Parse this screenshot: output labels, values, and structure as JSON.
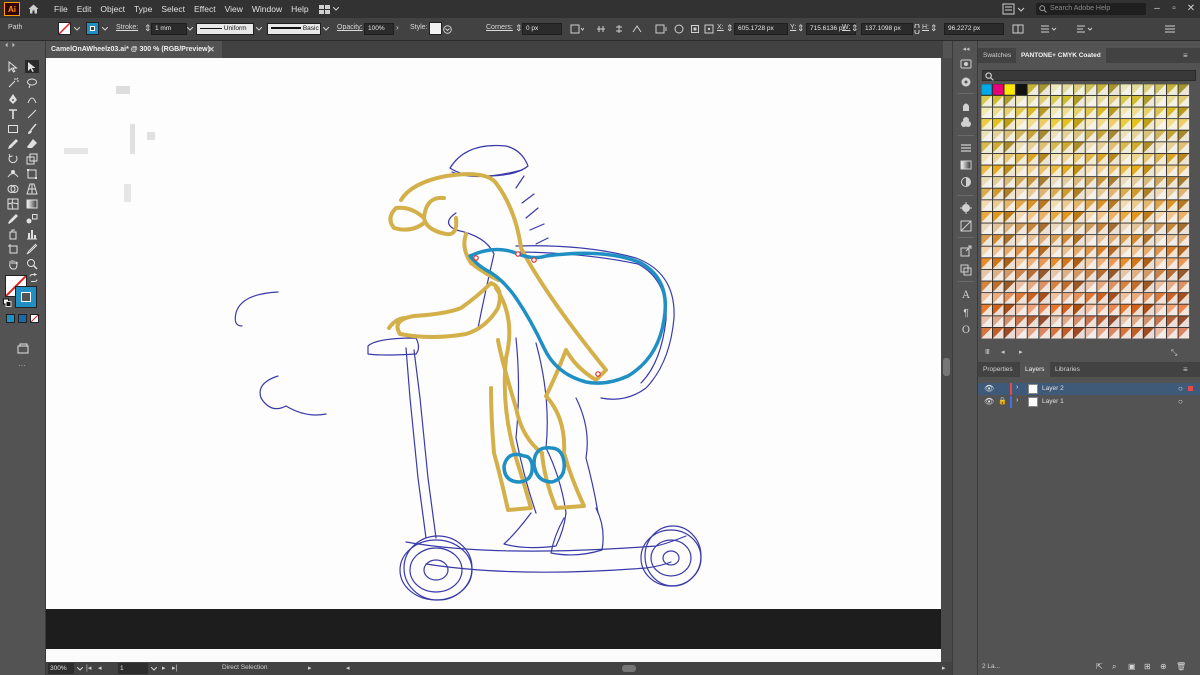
{
  "app": {
    "logo": "Ai",
    "menus": [
      "File",
      "Edit",
      "Object",
      "Type",
      "Select",
      "Effect",
      "View",
      "Window",
      "Help"
    ],
    "search_placeholder": "Search Adobe Help"
  },
  "control_bar": {
    "selection_type": "Path",
    "stroke_label": "Stroke:",
    "stroke_weight": "1 mm",
    "stroke_profile": "Uniform",
    "brush": "Basic",
    "opacity_label": "Opacity:",
    "opacity_value": "100%",
    "style_label": "Style:",
    "corners_label": "Corners:",
    "corners_value": "0 px",
    "x_label": "X:",
    "x_value": "605.1728 px",
    "y_label": "Y:",
    "y_value": "715.6136 px",
    "w_label": "W:",
    "w_value": "137.1098 px",
    "h_label": "H:",
    "h_value": "96.2272 px"
  },
  "document": {
    "tab_title": "CamelOnAWheelz03.ai* @ 300 % (RGB/Preview)"
  },
  "status_bar": {
    "zoom": "300%",
    "artboard_number": "1",
    "tool_name": "Direct Selection"
  },
  "swatches_panel": {
    "tabs": [
      "Swatches",
      "PANTONE+ CMYK Coated"
    ]
  },
  "layers_panel": {
    "tabs": [
      "Properties",
      "Layers",
      "Libraries"
    ],
    "layers": [
      {
        "name": "Layer 2",
        "color": "#e84a4a",
        "selected": true
      },
      {
        "name": "Layer 1",
        "color": "#4a6ee8",
        "selected": false
      }
    ],
    "count_label": "2 La..."
  },
  "colors": {
    "gold_path": "#d4b04a",
    "blue_path": "#1f8fc4",
    "sketch": "#3a3aa8"
  }
}
